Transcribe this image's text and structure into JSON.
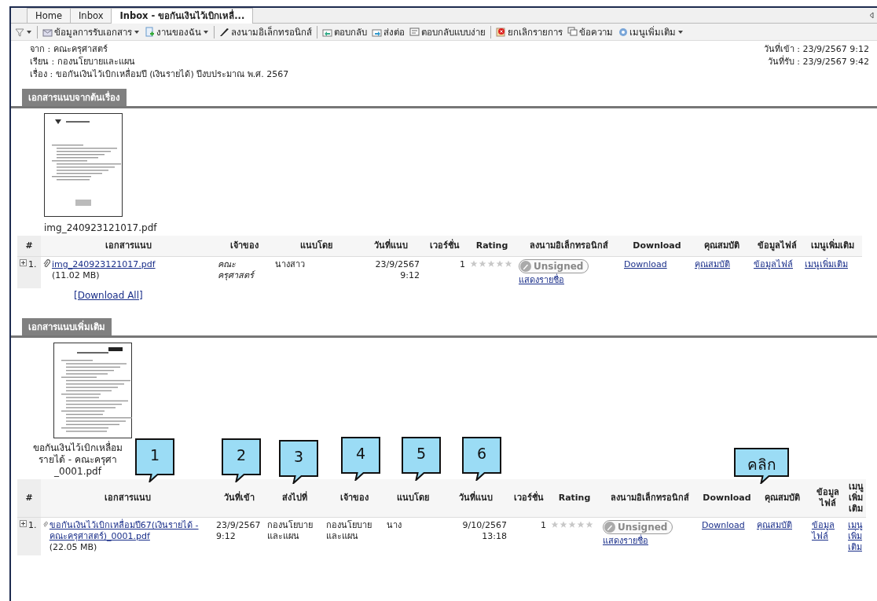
{
  "tabs": [
    {
      "label": "Home",
      "selected": false
    },
    {
      "label": "Inbox",
      "selected": false
    },
    {
      "label": "Inbox - ขอกันเงินไว้เบิกเหลื่...",
      "selected": true
    }
  ],
  "toolbar": [
    {
      "kind": "menu"
    },
    {
      "kind": "separator"
    },
    {
      "kind": "button",
      "label": "ข้อมูลการรับเอกสาร",
      "dropdown": true
    },
    {
      "kind": "button",
      "label": "งานของฉัน",
      "dropdown": true
    },
    {
      "kind": "separator"
    },
    {
      "kind": "button",
      "label": "ลงนามอิเล็กทรอนิกส์",
      "dropdown": false
    },
    {
      "kind": "separator"
    },
    {
      "kind": "button",
      "label": "ตอบกลับ",
      "dropdown": false
    },
    {
      "kind": "button",
      "label": "ส่งต่อ",
      "dropdown": false
    },
    {
      "kind": "button",
      "label": "ตอบกลับแบบง่าย",
      "dropdown": false
    },
    {
      "kind": "separator"
    },
    {
      "kind": "button",
      "label": "ยกเลิกรายการ",
      "dropdown": false
    },
    {
      "kind": "button",
      "label": "ข้อความ",
      "dropdown": false
    },
    {
      "kind": "button",
      "label": "เมนูเพิ่มเติม",
      "dropdown": true
    }
  ],
  "header": {
    "fields": [
      "จาก : คณะครุศาสตร์",
      "เรียน : กองนโยบายและแผน",
      "เรื่อง : ขอกันเงินไว้เบิกเหลื่อมปี (เงินรายได้) ปีงบประมาณ พ.ศ. 2567"
    ],
    "dates": [
      "วันที่เข้า : 23/9/2567 9:12",
      "วันที่รับ : 23/9/2567 9:42"
    ]
  },
  "sections": [
    {
      "title": "เอกสารแนบจากต้นเรื่อง",
      "caption": [
        "img_240923121017.pdf"
      ],
      "table": {
        "columns": [
          "#",
          "เอกสารแนบ",
          "เจ้าของ",
          "แนบโดย",
          "วันที่แนบ",
          "เวอร์ชั่น",
          "Rating",
          "ลงนามอิเล็กทรอนิกส์",
          "Download",
          "คุณสมบัติ",
          "ข้อมูลไฟล์",
          "เมนูเพิ่มเติม"
        ],
        "rows": [
          {
            "cells": [
              {
                "kind": "index",
                "text": "1."
              },
              {
                "kind": "file",
                "link": "img_240923121017.pdf",
                "size": "(11.02 MB)"
              },
              {
                "kind": "text",
                "text": "คณะ ครุศาสตร์",
                "italic": true
              },
              {
                "kind": "text",
                "text": "นางสาว",
                "italic": false
              },
              {
                "kind": "right",
                "text": "23/9/2567 9:12"
              },
              {
                "kind": "right",
                "text": "1"
              },
              {
                "kind": "rating",
                "stars": 0
              },
              {
                "kind": "signature",
                "badge": "Unsigned",
                "link": "แสดงรายชื่อ"
              },
              {
                "kind": "link",
                "text": "Download"
              },
              {
                "kind": "link",
                "text": "คุณสมบัติ"
              },
              {
                "kind": "link",
                "text": "ข้อมูลไฟล์"
              },
              {
                "kind": "link",
                "text": "เมนูเพิ่มเติม"
              }
            ]
          }
        ]
      },
      "download_all": "[Download All]"
    },
    {
      "title": "เอกสารแนบเพิ่มเติม",
      "caption": [
        "ขอกันเงินไว้เบิกเหลื่อม",
        "รายได้ - คณะครุศา",
        "_0001.pdf"
      ],
      "table": {
        "columns": [
          "#",
          "เอกสารแนบ",
          "วันที่เข้า",
          "ส่งไปที่",
          "เจ้าของ",
          "แนบโดย",
          "วันที่แนบ",
          "เวอร์ชั่น",
          "Rating",
          "ลงนามอิเล็กทรอนิกส์",
          "Download",
          "คุณสมบัติ",
          "ข้อมูลไฟล์",
          "เมนูเพิ่มเติม"
        ],
        "rows": [
          {
            "cells": [
              {
                "kind": "index",
                "text": "1."
              },
              {
                "kind": "file",
                "link": "ขอกันเงินไว้เบิกเหลื่อมปี67(เงินรายได้ - คณะครุศาสตร์)_0001.pdf",
                "size": "(22.05 MB)"
              },
              {
                "kind": "text",
                "text": "23/9/2567 9:12",
                "italic": false
              },
              {
                "kind": "text",
                "text": "กองนโยบายและแผน",
                "italic": false
              },
              {
                "kind": "text",
                "text": "กองนโยบายและแผน",
                "italic": false
              },
              {
                "kind": "text",
                "text": "นาง",
                "italic": false
              },
              {
                "kind": "right",
                "text": "9/10/2567 13:18"
              },
              {
                "kind": "right",
                "text": "1"
              },
              {
                "kind": "rating",
                "stars": 0
              },
              {
                "kind": "signature",
                "badge": "Unsigned",
                "link": "แสดงรายชื่อ"
              },
              {
                "kind": "link",
                "text": "Download"
              },
              {
                "kind": "link",
                "text": "คุณสมบัติ"
              },
              {
                "kind": "link",
                "text": "ข้อมูลไฟล์"
              },
              {
                "kind": "link",
                "text": "เมนูเพิ่มเติม"
              }
            ]
          }
        ]
      }
    }
  ],
  "callouts": [
    {
      "label": "1"
    },
    {
      "label": "2"
    },
    {
      "label": "3"
    },
    {
      "label": "4"
    },
    {
      "label": "5"
    },
    {
      "label": "6"
    },
    {
      "label": "คลิก"
    }
  ]
}
